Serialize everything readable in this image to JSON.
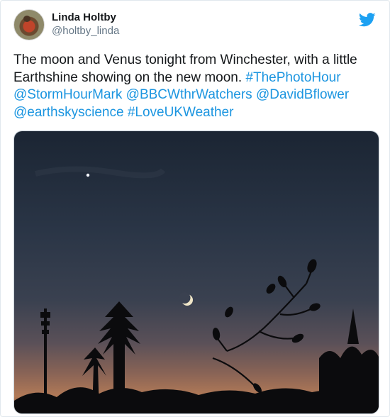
{
  "tweet": {
    "author": {
      "display_name": "Linda Holtby",
      "handle": "@holtby_linda",
      "avatar_icon": "robin-avatar"
    },
    "logo_icon": "twitter-bird-icon",
    "text_segments": [
      {
        "text": "The moon and Venus tonight from Winchester, with a little Earthshine showing on the new moon. ",
        "link": false
      },
      {
        "text": "#ThePhotoHour",
        "link": true
      },
      {
        "text": " ",
        "link": false
      },
      {
        "text": "@StormHourMark",
        "link": true
      },
      {
        "text": " ",
        "link": false
      },
      {
        "text": "@BBCWthrWatchers",
        "link": true
      },
      {
        "text": " ",
        "link": false
      },
      {
        "text": "@DavidBflower",
        "link": true
      },
      {
        "text": " ",
        "link": false
      },
      {
        "text": "@earthskyscience",
        "link": true
      },
      {
        "text": " ",
        "link": false
      },
      {
        "text": "#LoveUKWeather",
        "link": true
      }
    ],
    "photo": {
      "subject": "twilight-sky-moon-venus-silhouette"
    }
  },
  "colors": {
    "link": "#1b95e0",
    "text": "#14171a",
    "secondary": "#657786",
    "brand": "#1da1f2"
  }
}
